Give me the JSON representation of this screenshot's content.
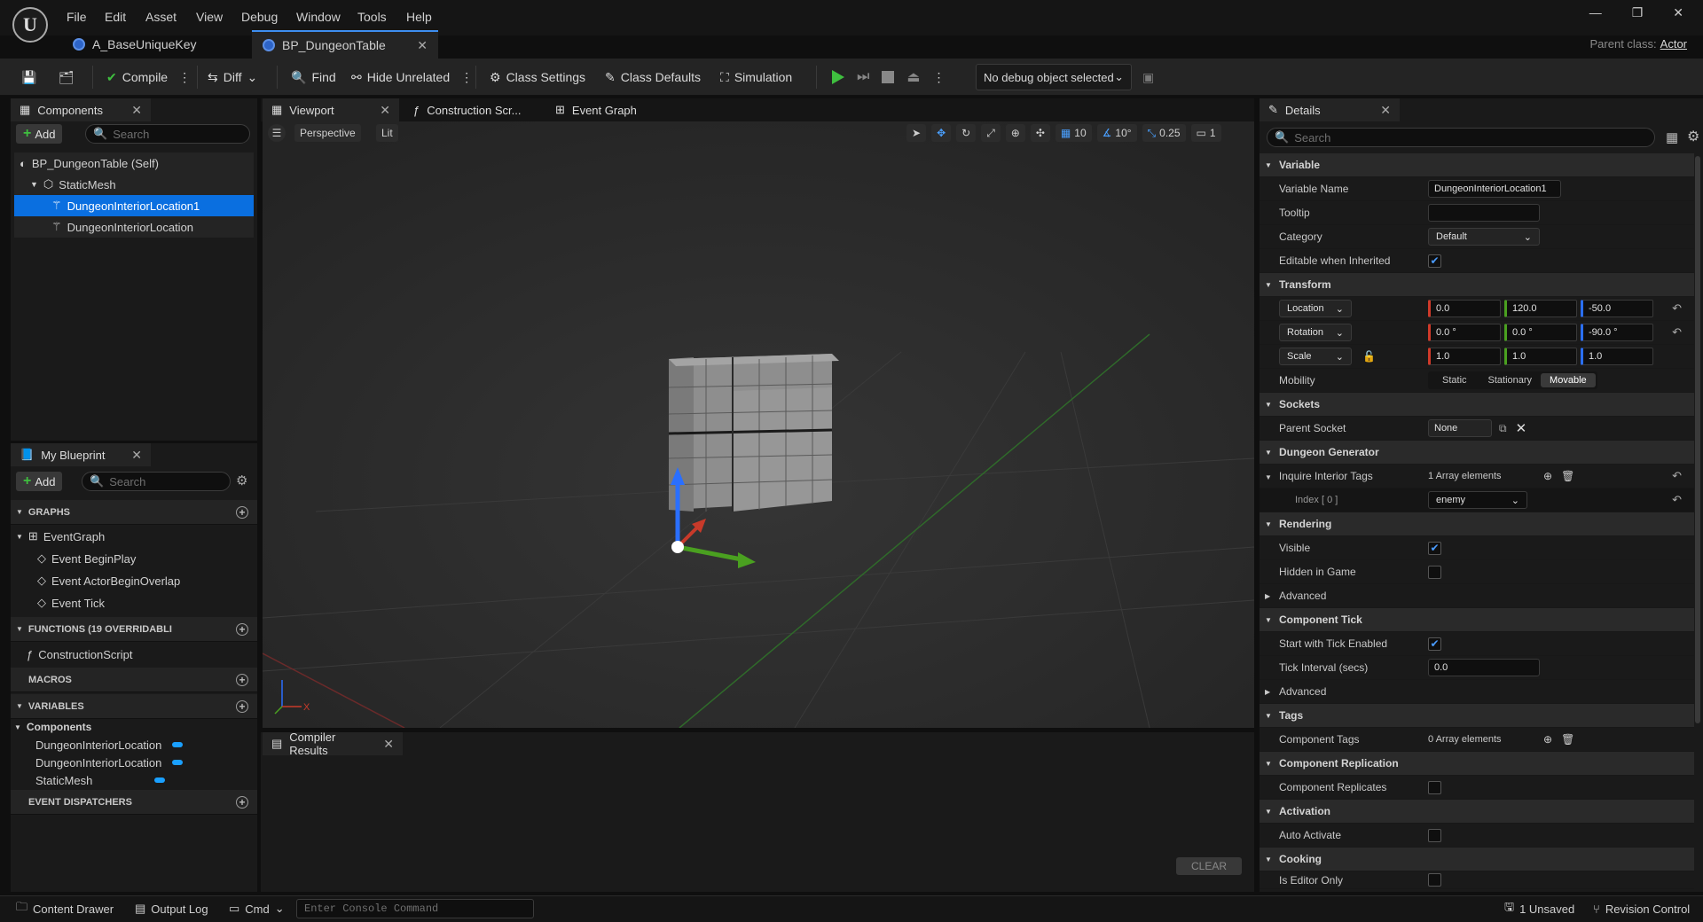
{
  "menu": [
    "File",
    "Edit",
    "Asset",
    "View",
    "Debug",
    "Window",
    "Tools",
    "Help"
  ],
  "doc_tabs": [
    {
      "label": "A_BaseUniqueKey"
    },
    {
      "label": "BP_DungeonTable"
    }
  ],
  "parent_class": {
    "label": "Parent class:",
    "value": "Actor"
  },
  "toolbar": {
    "compile": "Compile",
    "diff": "Diff",
    "find": "Find",
    "hide_unrelated": "Hide Unrelated",
    "class_settings": "Class Settings",
    "class_defaults": "Class Defaults",
    "simulation": "Simulation",
    "debug_select": "No debug object selected"
  },
  "components": {
    "tab": "Components",
    "add": "Add",
    "search_placeholder": "Search",
    "items": [
      "BP_DungeonTable (Self)",
      "StaticMesh",
      "DungeonInteriorLocation1",
      "DungeonInteriorLocation"
    ]
  },
  "my_blueprint": {
    "tab": "My Blueprint",
    "add": "Add",
    "search_placeholder": "Search",
    "graphs": "GRAPHS",
    "event_graph": "EventGraph",
    "events": [
      "Event BeginPlay",
      "Event ActorBeginOverlap",
      "Event Tick"
    ],
    "functions": "FUNCTIONS (19 OVERRIDABLI",
    "construction_script": "ConstructionScript",
    "macros": "MACROS",
    "variables": "VARIABLES",
    "components_cat": "Components",
    "vars": [
      "DungeonInteriorLocation",
      "DungeonInteriorLocation",
      "StaticMesh"
    ],
    "event_dispatchers": "EVENT DISPATCHERS"
  },
  "center_tabs": [
    "Viewport",
    "Construction Scr...",
    "Event Graph"
  ],
  "viewport": {
    "perspective": "Perspective",
    "lit": "Lit",
    "grid": "10",
    "angle": "10°",
    "scale": "0.25",
    "camera": "1",
    "axis_x": "X"
  },
  "compiler": {
    "tab": "Compiler Results",
    "clear": "CLEAR"
  },
  "details": {
    "tab": "Details",
    "search_placeholder": "Search",
    "variable": "Variable",
    "variable_name_label": "Variable Name",
    "variable_name": "DungeonInteriorLocation1",
    "tooltip_label": "Tooltip",
    "category_label": "Category",
    "category": "Default",
    "editable_label": "Editable when Inherited",
    "transform": "Transform",
    "location": "Location",
    "rotation": "Rotation",
    "scale": "Scale",
    "loc": [
      "0.0",
      "120.0",
      "-50.0"
    ],
    "rot": [
      "0.0 °",
      "0.0 °",
      "-90.0 °"
    ],
    "scl": [
      "1.0",
      "1.0",
      "1.0"
    ],
    "mobility_label": "Mobility",
    "mobility": [
      "Static",
      "Stationary",
      "Movable"
    ],
    "sockets": "Sockets",
    "parent_socket_label": "Parent Socket",
    "parent_socket": "None",
    "dungeon_gen": "Dungeon Generator",
    "inquire_label": "Inquire Interior Tags",
    "inquire_value": "1 Array elements",
    "index_label": "Index [ 0 ]",
    "index_value": "enemy",
    "rendering": "Rendering",
    "visible_label": "Visible",
    "hidden_label": "Hidden in Game",
    "advanced": "Advanced",
    "component_tick": "Component Tick",
    "start_tick_label": "Start with Tick Enabled",
    "tick_interval_label": "Tick Interval (secs)",
    "tick_interval": "0.0",
    "tags": "Tags",
    "component_tags_label": "Component Tags",
    "component_tags_value": "0 Array elements",
    "replication": "Component Replication",
    "replicates_label": "Component Replicates",
    "activation": "Activation",
    "auto_activate_label": "Auto Activate",
    "cooking": "Cooking",
    "editor_only_label": "Is Editor Only"
  },
  "status": {
    "content_drawer": "Content Drawer",
    "output_log": "Output Log",
    "cmd": "Cmd",
    "console_placeholder": "Enter Console Command",
    "unsaved": "1 Unsaved",
    "revision": "Revision Control"
  }
}
